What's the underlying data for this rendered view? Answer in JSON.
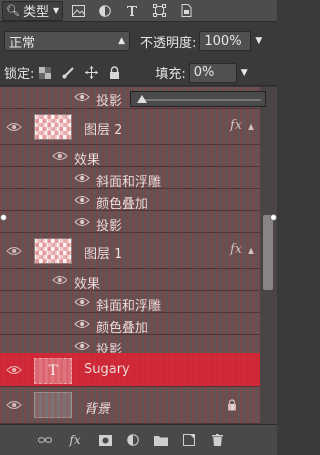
{
  "filter": {
    "label": "类型"
  },
  "blend_mode": {
    "value": "正常"
  },
  "opacity": {
    "label": "不透明度:",
    "value": "100%"
  },
  "lock": {
    "label": "锁定:"
  },
  "fill": {
    "label": "填充:",
    "value": "0%"
  },
  "layers": [
    {
      "name": "图层 2",
      "fx": "fx",
      "effects_label": "效果",
      "effects": [
        "斜面和浮雕",
        "颜色叠加",
        "投影"
      ]
    },
    {
      "name": "图层 1",
      "fx": "fx",
      "effects_label": "效果",
      "effects": [
        "斜面和浮雕",
        "颜色叠加",
        "投影"
      ]
    },
    {
      "name": "Sugary",
      "thumb_glyph": "T"
    },
    {
      "name": "背景"
    }
  ],
  "partial_effect": "投影",
  "bottom_bar": {
    "fx_label": "fx"
  },
  "colors": {
    "overlay": "#c81e28",
    "panel": "#3a3a3a",
    "selected_row": "#d02a3a"
  }
}
